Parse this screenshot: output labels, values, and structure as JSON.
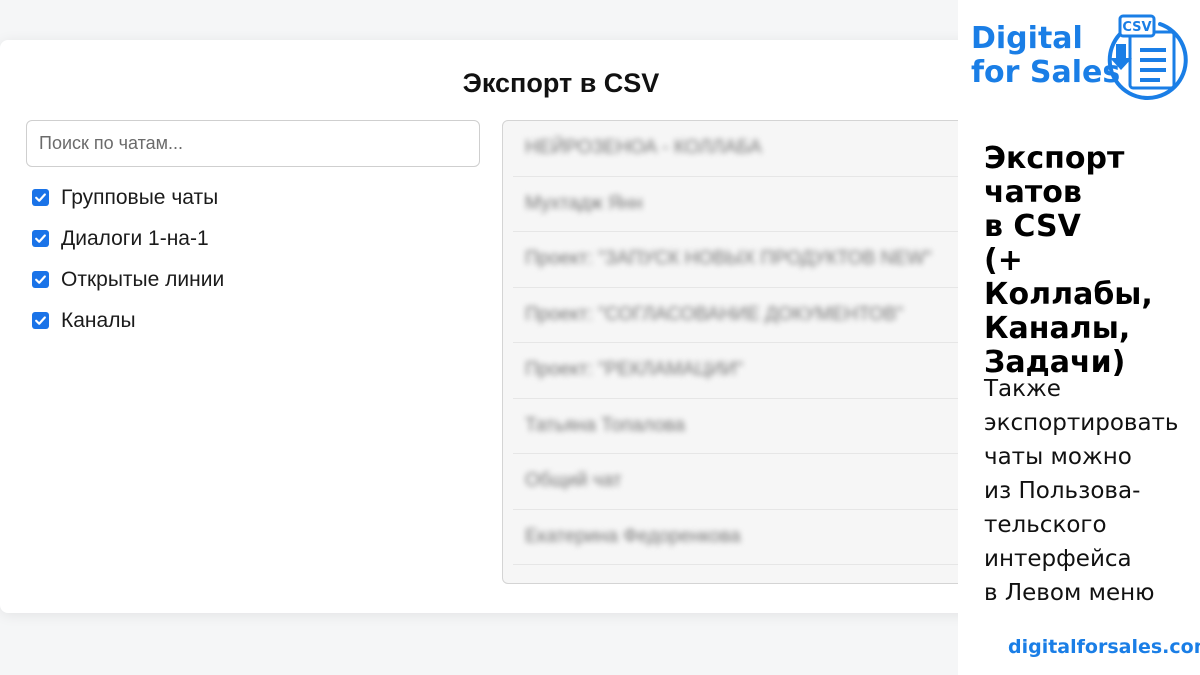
{
  "dialog": {
    "title": "Экспорт в CSV",
    "search_placeholder": "Поиск по чатам...",
    "filters": [
      {
        "label": "Групповые чаты",
        "checked": true
      },
      {
        "label": "Диалоги 1-на-1",
        "checked": true
      },
      {
        "label": "Открытые линии",
        "checked": true
      },
      {
        "label": "Каналы",
        "checked": true
      }
    ],
    "chat_items": [
      "НЕЙРОЗЕНОА - КОЛЛАБА",
      "Мухтадж Янн",
      "Проект: \"ЗАПУСК НОВЫХ ПРОДУКТОВ NEW\"",
      "Проект: \"СОГЛАСОВАНИЕ ДОКУМЕНТОВ\"",
      "Проект: \"РЕКЛАМАЦИИ\"",
      "Татьяна Топалова",
      "Общий чат",
      "Екатерина Федоренкова"
    ]
  },
  "promo": {
    "brand_line1": "Digital",
    "brand_line2": "for Sales",
    "logo_badge": "CSV",
    "title_lines": [
      "Экспорт",
      "чатов",
      "в CSV",
      "(+ Коллабы,",
      "Каналы,",
      "Задачи)"
    ],
    "desc_lines": [
      "Также",
      "экспортировать",
      "чаты можно",
      "из Пользова-",
      "тельского",
      "интерфейса",
      "в Левом меню"
    ],
    "url": "digitalforsales.com"
  },
  "colors": {
    "accent": "#1a7ee6",
    "checkbox": "#1a73e8"
  }
}
